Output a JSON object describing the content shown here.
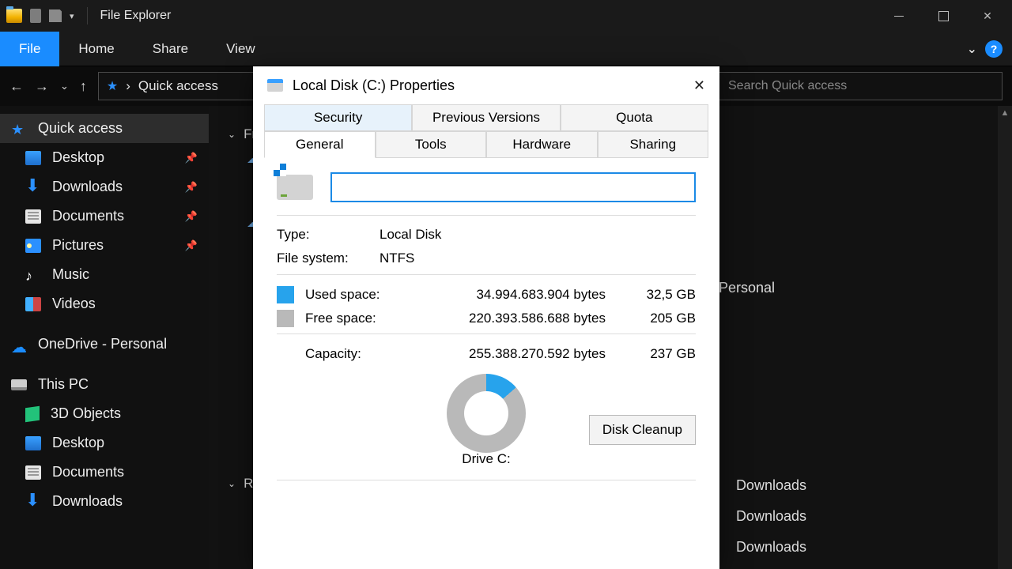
{
  "window": {
    "title": "File Explorer"
  },
  "ribbon": {
    "file": "File",
    "tabs": [
      "Home",
      "Share",
      "View"
    ]
  },
  "address": {
    "location": "Quick access",
    "search_placeholder": "Search Quick access"
  },
  "sidebar": {
    "quick": "Quick access",
    "items": [
      "Desktop",
      "Downloads",
      "Documents",
      "Pictures",
      "Music",
      "Videos"
    ],
    "onedrive": "OneDrive - Personal",
    "thispc": "This PC",
    "pc_items": [
      "3D Objects",
      "Desktop",
      "Documents",
      "Downloads"
    ]
  },
  "main": {
    "section1": "Frequent folders",
    "section2": "Recent files",
    "bg_personal": "OneDrive - Personal",
    "bg_items": [
      "Downloads",
      "Downloads",
      "Downloads"
    ]
  },
  "dialog": {
    "title": "Local Disk (C:) Properties",
    "tabs_top": [
      "Security",
      "Previous Versions",
      "Quota"
    ],
    "tabs_bot": [
      "General",
      "Tools",
      "Hardware",
      "Sharing"
    ],
    "name_value": "",
    "type_label": "Type:",
    "type_value": "Local Disk",
    "fs_label": "File system:",
    "fs_value": "NTFS",
    "used_label": "Used space:",
    "used_bytes": "34.994.683.904 bytes",
    "used_gb": "32,5 GB",
    "free_label": "Free space:",
    "free_bytes": "220.393.586.688 bytes",
    "free_gb": "205 GB",
    "cap_label": "Capacity:",
    "cap_bytes": "255.388.270.592 bytes",
    "cap_gb": "237 GB",
    "drive_label": "Drive C:",
    "cleanup": "Disk Cleanup"
  },
  "chart_data": {
    "type": "pie",
    "title": "Drive C: usage",
    "series": [
      {
        "name": "Used space",
        "value": 32.5,
        "unit": "GB",
        "bytes": 34994683904
      },
      {
        "name": "Free space",
        "value": 205,
        "unit": "GB",
        "bytes": 220393586688
      }
    ],
    "total": {
      "name": "Capacity",
      "value": 237,
      "unit": "GB",
      "bytes": 255388270592
    }
  }
}
